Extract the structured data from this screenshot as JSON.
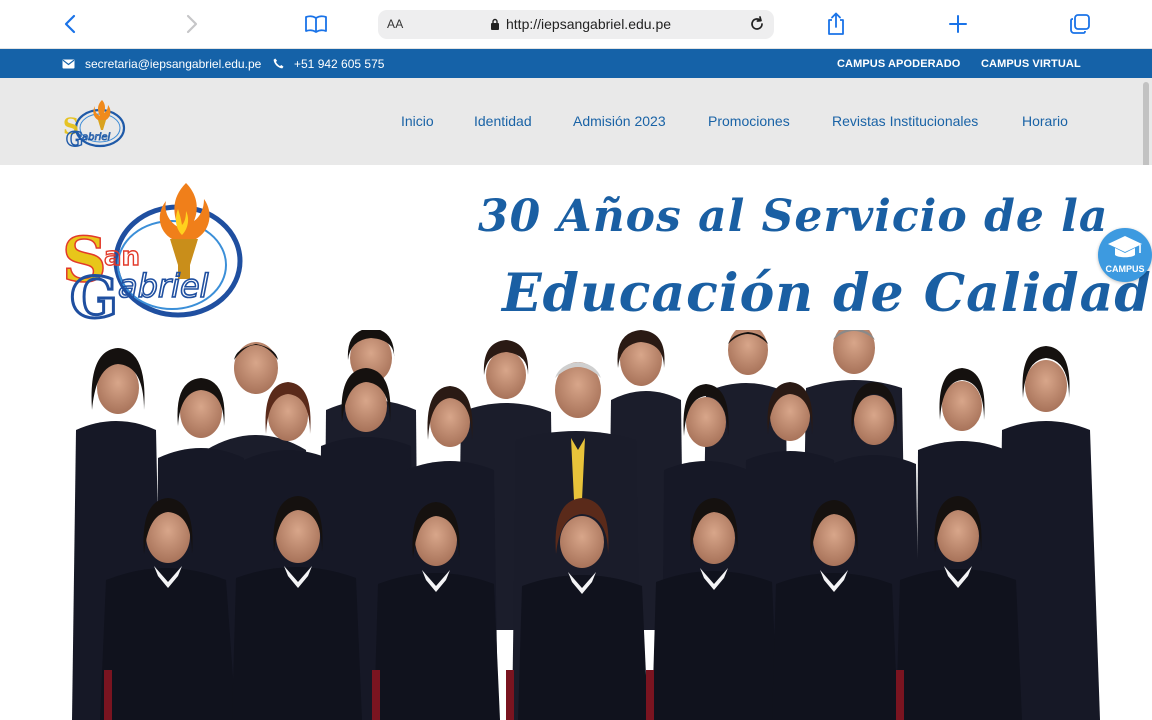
{
  "browser": {
    "text_size_label": "AA",
    "url": "http://iepsangabriel.edu.pe"
  },
  "topbar": {
    "email": "secretaria@iepsangabriel.edu.pe",
    "phone": "+51 942 605 575",
    "links": [
      "CAMPUS APODERADO",
      "CAMPUS VIRTUAL"
    ]
  },
  "nav": {
    "items": [
      "Inicio",
      "Identidad",
      "Admisión 2023",
      "Promociones",
      "Revistas Institucionales",
      "Horario"
    ]
  },
  "hero": {
    "title_line1": "30 Años al Servicio de la",
    "title_line2": "Educación de Calidad",
    "logo_text": "San Gabriel"
  },
  "floating": {
    "campus_label": "CAMPUS"
  },
  "colors": {
    "topbar": "#1562a8",
    "nav_bg": "#e9e9e9",
    "nav_link": "#1a63a6",
    "title": "#1a5fa3",
    "campus_button": "#3d9ae0"
  },
  "icons": [
    "back-icon",
    "forward-icon",
    "bookmarks-icon",
    "lock-icon",
    "reload-icon",
    "share-icon",
    "new-tab-icon",
    "tabs-icon",
    "email-icon",
    "phone-icon",
    "graduation-cap-icon"
  ]
}
